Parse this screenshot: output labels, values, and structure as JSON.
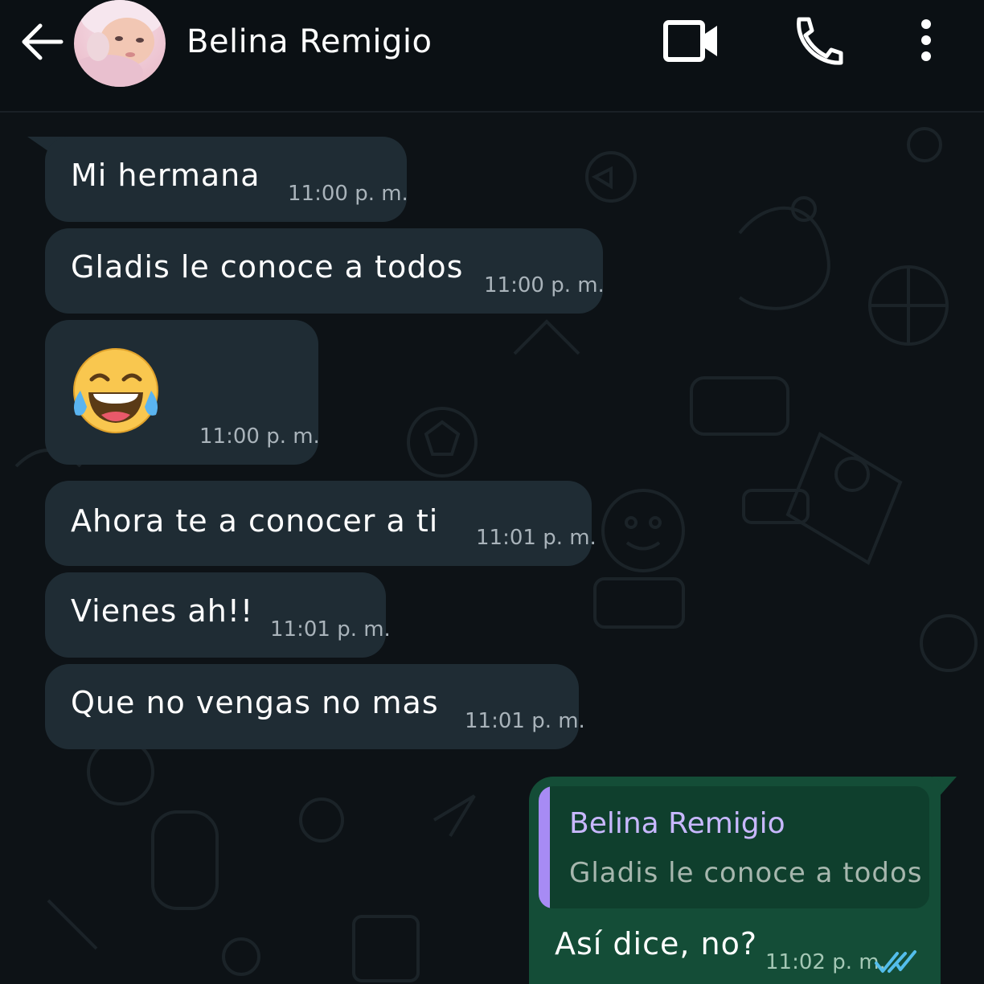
{
  "header": {
    "contact_name": "Belina Remigio",
    "back_icon": "arrow-left-icon",
    "video_icon": "video-camera-icon",
    "call_icon": "phone-icon",
    "menu_icon": "more-vertical-icon"
  },
  "messages": [
    {
      "type": "text",
      "text": "Mi hermana",
      "time": "11:00 p. m."
    },
    {
      "type": "text",
      "text": "Gladis le conoce a todos",
      "time": "11:00 p. m."
    },
    {
      "type": "emoji",
      "emoji": "face-with-tears-of-joy",
      "time": "11:00 p. m."
    },
    {
      "type": "text",
      "text": "Ahora te a conocer a ti",
      "time": "11:01 p. m."
    },
    {
      "type": "text",
      "text": "Vienes ah!!",
      "time": "11:01 p. m."
    },
    {
      "type": "text",
      "text": "Que no vengas no mas",
      "time": "11:01 p. m."
    }
  ],
  "outgoing": {
    "quoted_name": "Belina Remigio",
    "quoted_text": "Gladis le conoce a todos",
    "text": "Así dice, no?",
    "time": "11:02 p. m.",
    "status_icon": "double-check-read-icon"
  },
  "colors": {
    "background": "#0b1014",
    "incoming_bubble": "#1f2c34",
    "outgoing_bubble": "#144d37",
    "quote_accent": "#a78bf4",
    "read_ticks": "#53bdeb"
  }
}
